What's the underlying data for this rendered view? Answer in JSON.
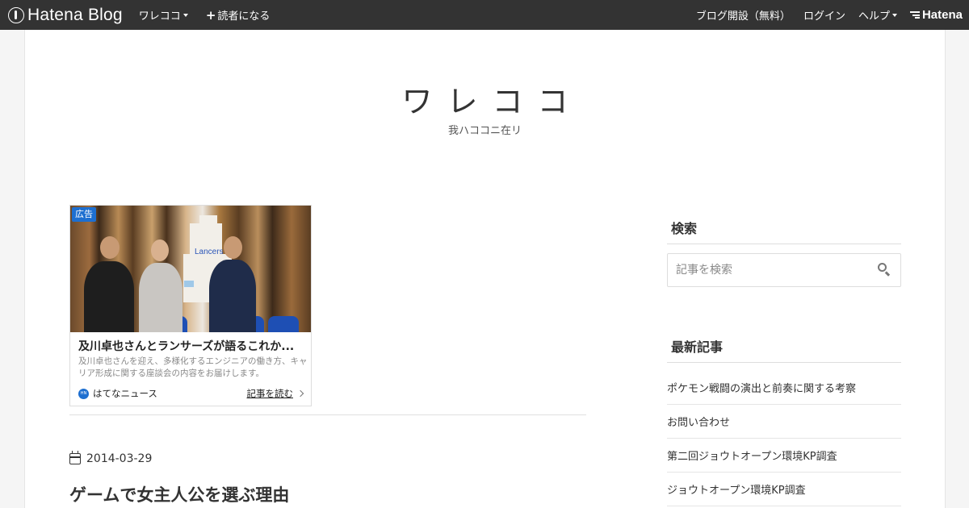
{
  "topbar": {
    "brand": "Hatena Blog",
    "blog_menu": "ワレココ",
    "subscribe": "読者になる",
    "open_blog": "ブログ開設（無料）",
    "login": "ログイン",
    "help": "ヘルプ",
    "hatena": "Hatena"
  },
  "header": {
    "title": "ワレココ",
    "description": "我ハココニ在リ"
  },
  "ad": {
    "badge": "広告",
    "title": "及川卓也さんとランサーズが語るこれか...",
    "body": "及川卓也さんを迎え、多様化するエンジニアの働き方、キャリア形成に関する座談会の内容をお届けします。",
    "source": "はてなニュース",
    "read_more": "記事を読む",
    "photo_sign": "Lancers"
  },
  "post": {
    "date": "2014-03-29",
    "title": "ゲームで女主人公を選ぶ理由"
  },
  "sidebar": {
    "search_heading": "検索",
    "search_placeholder": "記事を検索",
    "recent_heading": "最新記事",
    "recent": [
      "ポケモン戦闘の演出と前奏に関する考察",
      "お問い合わせ",
      "第二回ジョウトオープン環境KP調査",
      "ジョウトオープン環境KP調査"
    ]
  }
}
